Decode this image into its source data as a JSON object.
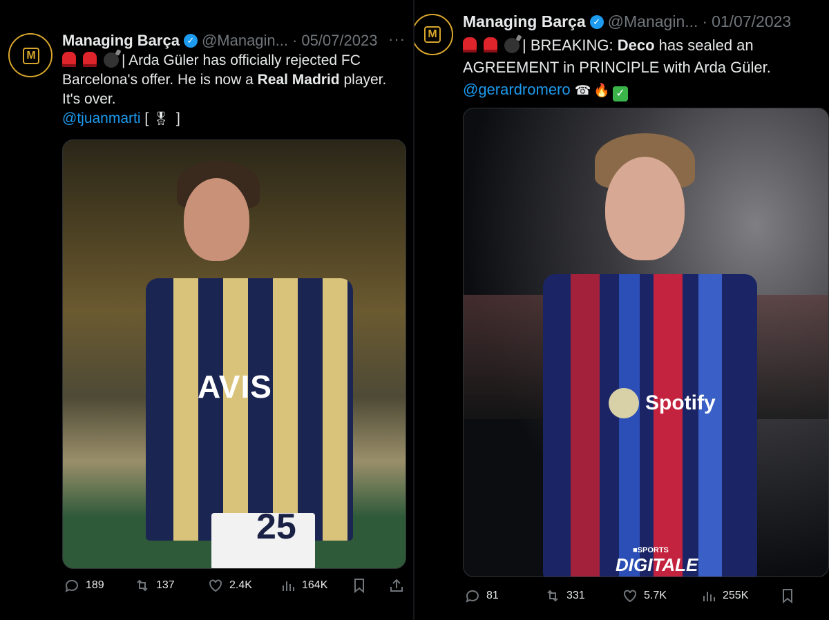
{
  "tweets": [
    {
      "author_name": "Managing Barça",
      "handle": "@Managin...",
      "dot": "·",
      "date": "05/07/2023",
      "more": "···",
      "avatar_text": "M",
      "text": {
        "part1": "| Arda Güler has officially rejected FC Barcelona's offer. He is now a ",
        "bold": "Real Madrid",
        "part2": " player. It's over.",
        "mention": "@tjuanmarti",
        "tail_open": " [",
        "tail_close": " ]"
      },
      "media": {
        "sponsor": "AVIS",
        "number": "25"
      },
      "stats": {
        "replies": "189",
        "retweets": "137",
        "likes": "2.4K",
        "views": "164K"
      }
    },
    {
      "author_name": "Managing Barça",
      "handle": "@Managin...",
      "dot": "·",
      "date": "01/07/2023",
      "avatar_text": "M",
      "text": {
        "part1": "| BREAKING: ",
        "bold": "Deco",
        "part2": " has sealed an AGREEMENT in PRINCIPLE with Arda Güler.",
        "mention": "@gerardromero"
      },
      "media": {
        "sponsor": "Spotify",
        "watermark_top": "■SPORTS",
        "watermark": "DIGITALE"
      },
      "stats": {
        "replies": "81",
        "retweets": "331",
        "likes": "5.7K",
        "views": "255K"
      }
    }
  ],
  "icons": [
    "reply-icon",
    "retweet-icon",
    "like-icon",
    "views-icon",
    "bookmark-icon",
    "share-icon"
  ],
  "colors": {
    "accent": "#1d9bf0",
    "muted": "#71767b",
    "text": "#e7e9ea",
    "background": "#000000",
    "avatar_gold": "#d9a72c"
  }
}
